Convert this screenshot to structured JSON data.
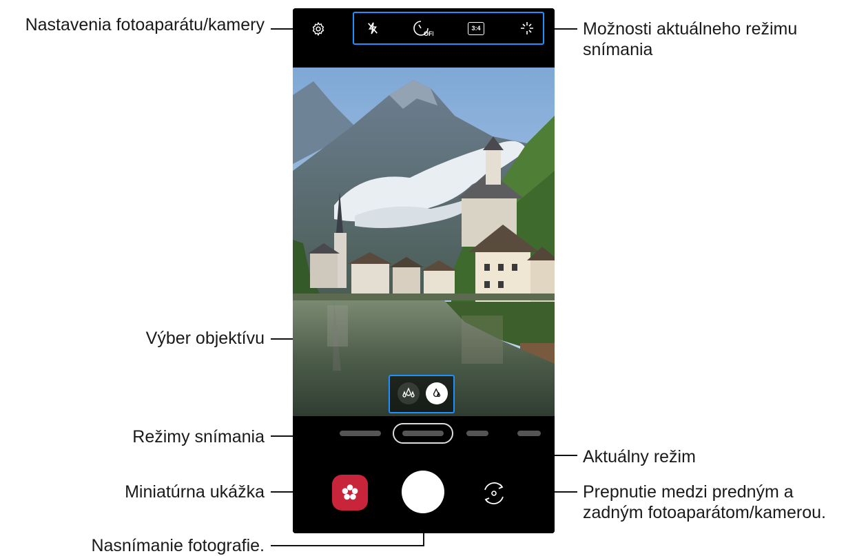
{
  "callouts": {
    "settings": "Nastavenia fotoaparátu/kamery",
    "options": "Možnosti aktuálneho režimu snímania",
    "lens": "Výber objektívu",
    "modes": "Režimy snímania",
    "current_mode": "Aktuálny režim",
    "thumbnail": "Miniatúrna ukážka",
    "switch_camera": "Prepnutie medzi predným a zadným fotoaparátom/kamerou.",
    "capture": "Nasnímanie fotografie."
  },
  "options_bar": {
    "flash_icon": "flash-off-icon",
    "timer_icon": "timer-off-icon",
    "timer_text": "OFF",
    "ratio_text": "3:4",
    "effects_icon": "sparkle-icon"
  },
  "colors": {
    "accent": "#1e90ff",
    "thumbnail": "#c8243a"
  }
}
